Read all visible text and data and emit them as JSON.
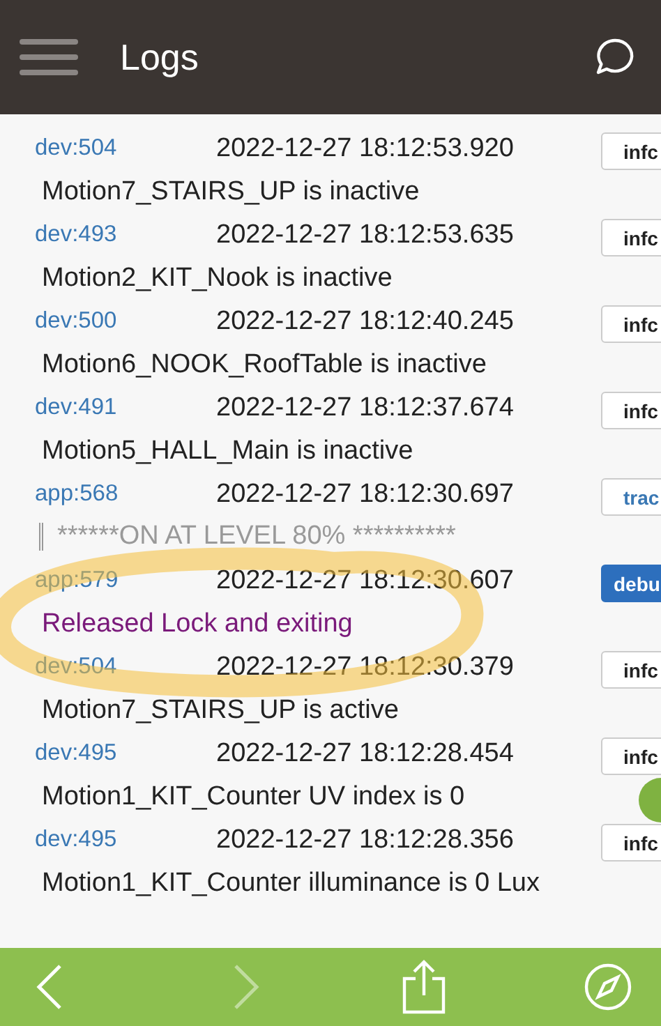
{
  "header": {
    "title": "Logs"
  },
  "logs": [
    {
      "source": "dev:504",
      "time": "2022-12-27 18:12:53.920",
      "level": "infc",
      "kind": "info",
      "message": "Motion7_STAIRS_UP is inactive"
    },
    {
      "source": "dev:493",
      "time": "2022-12-27 18:12:53.635",
      "level": "infc",
      "kind": "info",
      "message": "Motion2_KIT_Nook is inactive"
    },
    {
      "source": "dev:500",
      "time": "2022-12-27 18:12:40.245",
      "level": "infc",
      "kind": "info",
      "message": "Motion6_NOOK_RoofTable is inactive"
    },
    {
      "source": "dev:491",
      "time": "2022-12-27 18:12:37.674",
      "level": "infc",
      "kind": "info",
      "message": "Motion5_HALL_Main is inactive"
    },
    {
      "source": "app:568",
      "time": "2022-12-27 18:12:30.697",
      "level": "trac",
      "kind": "trace",
      "message": "******ON AT LEVEL 80% **********"
    },
    {
      "source": "app:579",
      "time": "2022-12-27 18:12:30.607",
      "level": "debu",
      "kind": "debug",
      "message": "Released Lock and exiting"
    },
    {
      "source": "dev:504",
      "time": "2022-12-27 18:12:30.379",
      "level": "infc",
      "kind": "info",
      "message": "Motion7_STAIRS_UP is active"
    },
    {
      "source": "dev:495",
      "time": "2022-12-27 18:12:28.454",
      "level": "infc",
      "kind": "info",
      "message": "Motion1_KIT_Counter UV index is 0"
    },
    {
      "source": "dev:495",
      "time": "2022-12-27 18:12:28.356",
      "level": "infc",
      "kind": "info",
      "message": "Motion1_KIT_Counter illuminance is 0 Lux"
    }
  ],
  "annotation": {
    "kind": "ellipse"
  },
  "bottom_bar": {
    "back_disabled": false,
    "forward_disabled": true
  }
}
